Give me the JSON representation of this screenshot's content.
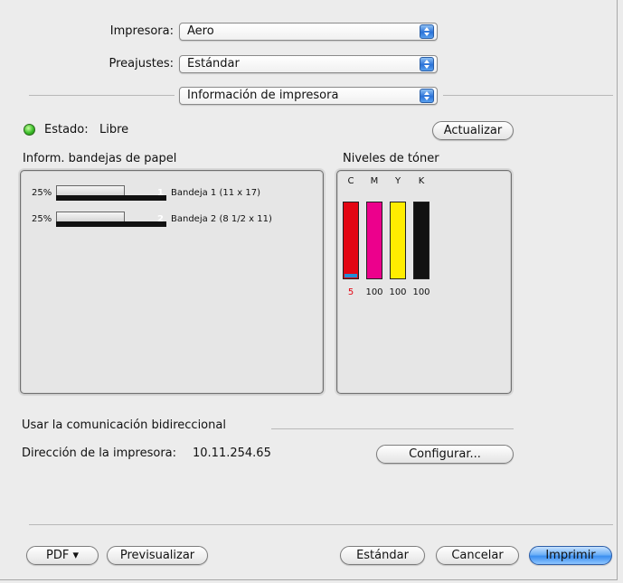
{
  "printer": {
    "label": "Impresora:",
    "value": "Aero"
  },
  "presets": {
    "label": "Preajustes:",
    "value": "Estándar"
  },
  "panel": {
    "value": "Información de impresora"
  },
  "status": {
    "label": "Estado:",
    "value": "Libre",
    "color": "#3bbd2a"
  },
  "refresh_button": "Actualizar",
  "trays": {
    "title": "Inform. bandejas de papel",
    "items": [
      {
        "percent": "25%",
        "number": "1",
        "name": "Bandeja 1 (11 x 17)",
        "fill_fraction": 0.25
      },
      {
        "percent": "25%",
        "number": "2",
        "name": "Bandeja 2 (8 1/2 x 11)",
        "fill_fraction": 0.25
      }
    ]
  },
  "toner": {
    "title": "Niveles de tóner",
    "colors": [
      {
        "letter": "C",
        "value": "5",
        "level": 5,
        "color": "#e30613",
        "fill": "#1f8fd6",
        "value_color": "#e30613"
      },
      {
        "letter": "M",
        "value": "100",
        "level": 100,
        "color": "#ec008c",
        "fill": "#ec008c",
        "value_color": "#111111"
      },
      {
        "letter": "Y",
        "value": "100",
        "level": 100,
        "color": "#ffed00",
        "fill": "#ffed00",
        "value_color": "#111111"
      },
      {
        "letter": "K",
        "value": "100",
        "level": 100,
        "color": "#111111",
        "fill": "#111111",
        "value_color": "#111111"
      }
    ]
  },
  "bidirectional": {
    "label": "Usar la comunicación bidireccional"
  },
  "address": {
    "label": "Dirección de la impresora:",
    "value": "10.11.254.65"
  },
  "configure_button": "Configurar...",
  "footer": {
    "pdf": "PDF ▾",
    "preview": "Previsualizar",
    "standard": "Estándar",
    "cancel": "Cancelar",
    "print": "Imprimir"
  }
}
